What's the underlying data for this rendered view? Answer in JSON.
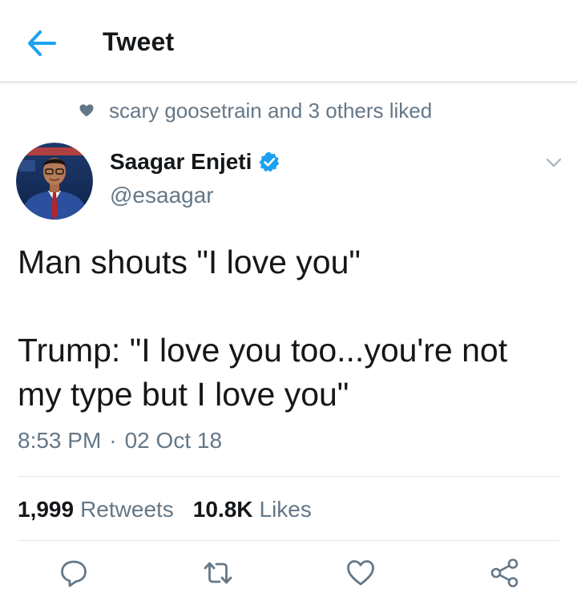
{
  "header": {
    "title": "Tweet",
    "back_icon": "arrow-left-icon",
    "accent_color": "#1da1f2"
  },
  "social_context": {
    "icon": "heart-icon",
    "text": "scary goosetrain and 3 others liked"
  },
  "tweet": {
    "author": {
      "name": "Saagar Enjeti",
      "handle": "@esaagar",
      "verified": true
    },
    "text_lines": [
      "Man shouts \"I love you\"",
      "",
      "Trump: \"I love you too...you're not",
      "my type but I love you\""
    ],
    "time": "8:53 PM",
    "separator": "·",
    "date": "02 Oct 18"
  },
  "stats": {
    "retweets_count": "1,999",
    "retweets_label": "Retweets",
    "likes_count": "10.8K",
    "likes_label": "Likes"
  },
  "actions": [
    "reply-icon",
    "retweet-icon",
    "like-icon",
    "share-icon"
  ],
  "colors": {
    "text_primary": "#14171a",
    "text_secondary": "#657786",
    "divider": "#e1e8ed",
    "verified": "#1da1f2"
  }
}
